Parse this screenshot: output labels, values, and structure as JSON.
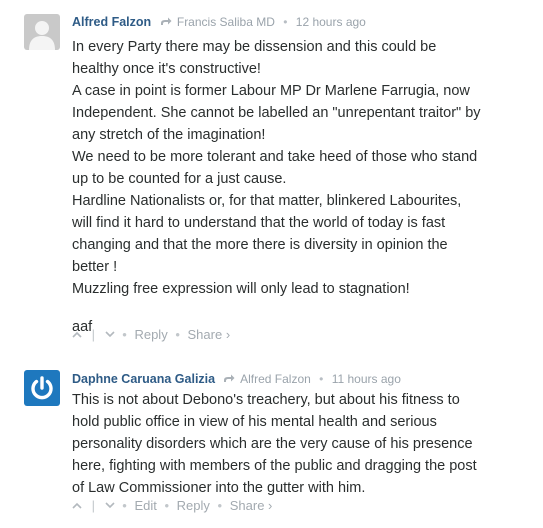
{
  "comments": [
    {
      "author": "Alfred Falzon",
      "reply_to": "Francis Saliba MD",
      "separator": "•",
      "time": "12 hours ago",
      "avatar_icon": "default-user-avatar-icon",
      "lines": [
        "In every Party there may be dissension and this could be",
        "healthy once it's constructive!",
        "A case in point is former Labour MP Dr Marlene Farrugia, now",
        "Independent. She cannot be labelled an \"unrepentant traitor\" by",
        "any stretch of the imagination!",
        "We need to be more tolerant and take heed of those who stand",
        "up to be counted for a just cause.",
        "Hardline Nationalists or, for that matter, blinkered Labourites,",
        "will find it hard to understand that the world of today is fast",
        "changing and that the more there is diversity in opinion the",
        "better !",
        "Muzzling free expression will only lead to stagnation!"
      ],
      "signoff": "aaf",
      "actions": {
        "reply": "Reply",
        "share": "Share ›",
        "sep": "|",
        "dot": "•"
      }
    },
    {
      "author": "Daphne Caruana Galizia",
      "reply_to": "Alfred Falzon",
      "separator": "•",
      "time": "11 hours ago",
      "avatar_icon": "power-logo-avatar-icon",
      "lines": [
        "This is not about Debono's treachery, but about his fitness to",
        "hold public office in view of his mental health and serious",
        "personality disorders which are the very cause of his presence",
        "here, fighting with members of the public and dragging the post",
        "of Law Commissioner into the gutter with him."
      ],
      "actions": {
        "edit": "Edit",
        "reply": "Reply",
        "share": "Share ›",
        "sep": "|",
        "dot": "•"
      }
    }
  ],
  "colors": {
    "author": "#2e5b86",
    "meta": "#9aa3ab",
    "text": "#2a2e2e",
    "brand_avatar": "#1e78be"
  }
}
